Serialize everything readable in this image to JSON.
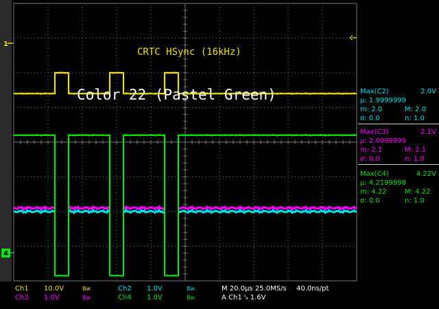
{
  "annotations": {
    "hsync_label": "CRTC HSync (16kHz)",
    "color_label": "Color 22 (Pastel Green)"
  },
  "colors": {
    "ch1": "#f0e000",
    "ch2": "#00e0e8",
    "ch3": "#ff00ff",
    "ch4": "#10e010",
    "grid": "#7a7a7a",
    "text": "#ffffff"
  },
  "markers": {
    "ch1_label": "1",
    "ch4_label": "4"
  },
  "measurements": [
    {
      "title": "Max(C2)",
      "value": "2.0V",
      "mean_label": "μ:",
      "mean": "1.9999999",
      "min": "m: 2.0",
      "max": "M: 2.0",
      "sigma": "σ: 0.0",
      "n": "n: 1.0"
    },
    {
      "title": "Max(C3)",
      "value": "2.1V",
      "mean_label": "μ:",
      "mean": "2.0999999",
      "min": "m: 2.1",
      "max": "M: 2.1",
      "sigma": "σ: 0.0",
      "n": "n: 1.0"
    },
    {
      "title": "Max(C4)",
      "value": "4.22V",
      "mean_label": "μ:",
      "mean": "4.2199998",
      "min": "m: 4.22",
      "max": "M: 4.22",
      "sigma": "σ: 0.0",
      "n": "n: 1.0"
    }
  ],
  "status": {
    "ch1": "Ch1",
    "ch1_scale": "10.0V",
    "ch2": "Ch2",
    "ch2_scale": "1.0V",
    "ch3": "Ch3",
    "ch3_scale": "1.0V",
    "ch4": "Ch4",
    "ch4_scale": "1.0V",
    "bw": "Bw",
    "timebase": "M 20.0μs 25.0MS/s",
    "resolution": "40.0ns/pt",
    "trigger": "A  Ch1  ⤥  1.6V"
  },
  "chart_data": {
    "type": "line",
    "grid": true,
    "x_divisions": 10,
    "y_divisions": 8,
    "x_unit": "μs",
    "x_per_division": 20,
    "x_range": [
      0,
      200
    ],
    "series": [
      {
        "name": "Ch1",
        "color": "#f0e000",
        "volts_per_div": 10,
        "level_low_div": 5.4,
        "level_high_div": 6.0,
        "pulses": [
          [
            24,
            32
          ],
          [
            56,
            64
          ],
          [
            88,
            96
          ]
        ]
      },
      {
        "name": "Ch4",
        "color": "#10e010",
        "volts_per_div": 1,
        "level_low_div": 0.15,
        "level_high_div": 4.2,
        "pulses": [
          [
            24,
            32
          ],
          [
            56,
            64
          ],
          [
            88,
            96
          ]
        ],
        "pulse_is_low": true
      },
      {
        "name": "Ch3",
        "color": "#ff00ff",
        "volts_per_div": 1,
        "level_div": 2.1,
        "gaps": [
          [
            24,
            32
          ],
          [
            56,
            64
          ],
          [
            88,
            96
          ]
        ]
      },
      {
        "name": "Ch2",
        "color": "#00e0e8",
        "volts_per_div": 1,
        "level_div": 2.0,
        "gaps": [
          [
            24,
            32
          ],
          [
            56,
            64
          ],
          [
            88,
            96
          ]
        ]
      }
    ]
  }
}
